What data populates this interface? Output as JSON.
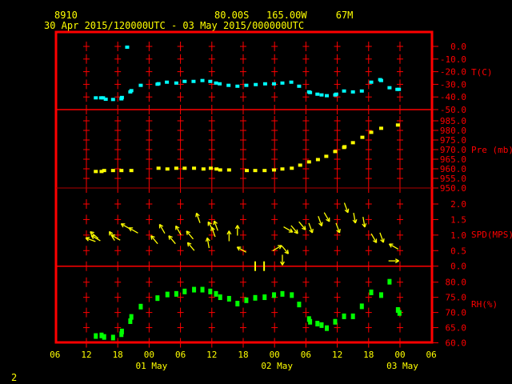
{
  "header": {
    "station": "8910",
    "location": "80.00S   165.00W     67M",
    "period": "30 Apr 2015/120000UTC - 03 May 2015/000000UTC"
  },
  "footer": {
    "page_number": "2"
  },
  "colors": {
    "frame": "#ff0000",
    "text": "#ffff00",
    "temperature": "#00ffff",
    "pressure": "#ffff00",
    "wind": "#ffff00",
    "rh": "#00ff00"
  },
  "chart_data": {
    "type": "scatter",
    "x_unit": "hours since 30 Apr 2015 12UTC",
    "xlim": [
      -6,
      66
    ],
    "x_ticks": [
      {
        "h": -6,
        "label": "06"
      },
      {
        "h": 0,
        "label": "12"
      },
      {
        "h": 6,
        "label": "18"
      },
      {
        "h": 12,
        "label": "00"
      },
      {
        "h": 18,
        "label": "06"
      },
      {
        "h": 24,
        "label": "12"
      },
      {
        "h": 30,
        "label": "18"
      },
      {
        "h": 36,
        "label": "00"
      },
      {
        "h": 42,
        "label": "06"
      },
      {
        "h": 48,
        "label": "12"
      },
      {
        "h": 54,
        "label": "18"
      },
      {
        "h": 60,
        "label": "00"
      },
      {
        "h": 66,
        "label": "06"
      }
    ],
    "date_labels": [
      {
        "h": 12,
        "label": "01 May"
      },
      {
        "h": 36,
        "label": "02 May"
      },
      {
        "h": 60,
        "label": "03 May"
      }
    ],
    "panels": [
      {
        "name": "temperature",
        "label": "T(C)",
        "ylim": [
          -50,
          0
        ],
        "ticks": [
          "0.0",
          "-10.0",
          "-20.0",
          "-30.0",
          "-40.0",
          "-50.0"
        ],
        "tick_values": [
          0,
          -10,
          -20,
          -30,
          -40,
          -50
        ],
        "points": [
          [
            1.8,
            -40.7
          ],
          [
            2.8,
            -40.7
          ],
          [
            3.2,
            -40.7
          ],
          [
            3.7,
            -41.8
          ],
          [
            5.1,
            -42
          ],
          [
            6.7,
            -41.5
          ],
          [
            6.8,
            -40.4
          ],
          [
            7.8,
            -0.6
          ],
          [
            8.4,
            -36
          ],
          [
            8.6,
            -35
          ],
          [
            10.4,
            -30.8
          ],
          [
            13.6,
            -29.9
          ],
          [
            13.8,
            -29.5
          ],
          [
            15.4,
            -28.3
          ],
          [
            17.2,
            -29
          ],
          [
            18.8,
            -27.7
          ],
          [
            20.5,
            -27.7
          ],
          [
            22.2,
            -27
          ],
          [
            23.7,
            -27.7
          ],
          [
            24.8,
            -29
          ],
          [
            25.5,
            -29.6
          ],
          [
            27.2,
            -30.8
          ],
          [
            28.9,
            -31.5
          ],
          [
            30.6,
            -30.8
          ],
          [
            32.4,
            -30.2
          ],
          [
            34.2,
            -29.6
          ],
          [
            35.9,
            -29.6
          ],
          [
            37.5,
            -29
          ],
          [
            39.2,
            -28.3
          ],
          [
            40.7,
            -31.5
          ],
          [
            42.6,
            -36
          ],
          [
            42.8,
            -36.5
          ],
          [
            44.2,
            -37.8
          ],
          [
            45,
            -38.4
          ],
          [
            46,
            -39
          ],
          [
            47.6,
            -38.4
          ],
          [
            47.8,
            -37.8
          ],
          [
            49.3,
            -35.3
          ],
          [
            51,
            -36
          ],
          [
            52.7,
            -35.3
          ],
          [
            54.5,
            -28.3
          ],
          [
            56.2,
            -26.3
          ],
          [
            56.4,
            -27
          ],
          [
            58,
            -32.7
          ],
          [
            59.5,
            -34
          ],
          [
            59.8,
            -34
          ]
        ]
      },
      {
        "name": "pressure",
        "label": "Pre (mb)",
        "ylim": [
          950,
          985
        ],
        "ticks": [
          "985.0",
          "980.0",
          "975.0",
          "970.0",
          "965.0",
          "960.0",
          "955.0",
          "950.0"
        ],
        "tick_values": [
          985,
          980,
          975,
          970,
          965,
          960,
          955,
          950
        ],
        "points": [
          [
            1.8,
            958.6
          ],
          [
            2.9,
            958.6
          ],
          [
            3.4,
            959.1
          ],
          [
            5.1,
            959.1
          ],
          [
            6.7,
            959.1
          ],
          [
            8.6,
            959.1
          ],
          [
            13.8,
            960.3
          ],
          [
            15.5,
            959.9
          ],
          [
            17.2,
            960.3
          ],
          [
            18.8,
            960.3
          ],
          [
            20.6,
            960.3
          ],
          [
            22.4,
            959.9
          ],
          [
            23.8,
            960.3
          ],
          [
            24.9,
            959.9
          ],
          [
            25.6,
            959.4
          ],
          [
            27.3,
            959.4
          ],
          [
            30.7,
            959.1
          ],
          [
            32.3,
            959.1
          ],
          [
            34.1,
            959.1
          ],
          [
            35.9,
            959.4
          ],
          [
            37.5,
            959.9
          ],
          [
            39.3,
            960.3
          ],
          [
            40.9,
            961.9
          ],
          [
            42.6,
            963.6
          ],
          [
            44.3,
            964.8
          ],
          [
            45.9,
            966.5
          ],
          [
            47.6,
            969
          ],
          [
            49.3,
            971.1
          ],
          [
            49.4,
            971.5
          ],
          [
            51,
            973.6
          ],
          [
            52.8,
            976.4
          ],
          [
            54.5,
            979
          ],
          [
            56.4,
            981.1
          ],
          [
            59.6,
            982.8
          ]
        ]
      },
      {
        "name": "wind_speed",
        "label": "SPD(MPS)",
        "ylim": [
          0,
          2
        ],
        "ticks": [
          "2.0",
          "1.5",
          "1.0",
          "0.5",
          "0.0"
        ],
        "tick_values": [
          2,
          1.5,
          1,
          0.5,
          0
        ],
        "points_note": "[hour, speed m/s, arrow direction degrees clockwise from up]",
        "points": [
          [
            0.8,
            0.85,
            290
          ],
          [
            1.8,
            0.9,
            300
          ],
          [
            1.5,
            1.0,
            310
          ],
          [
            4.9,
            0.97,
            330
          ],
          [
            5.6,
            0.92,
            300
          ],
          [
            7.5,
            1.28,
            300
          ],
          [
            9,
            1.15,
            300
          ],
          [
            13,
            0.85,
            320
          ],
          [
            14.5,
            1.2,
            330
          ],
          [
            16.4,
            0.85,
            320
          ],
          [
            17.6,
            1.15,
            330
          ],
          [
            19.8,
            1.0,
            320
          ],
          [
            20,
            0.63,
            320
          ],
          [
            21.4,
            1.55,
            340
          ],
          [
            23.3,
            0.75,
            350
          ],
          [
            23.8,
            1.28,
            330
          ],
          [
            24.8,
            1.3,
            340
          ],
          [
            24.3,
            1.1,
            340
          ],
          [
            27.3,
            0.97,
            0
          ],
          [
            28.9,
            1.15,
            0
          ],
          [
            29.7,
            0.53,
            300
          ],
          [
            32.3,
            0,
            0
          ],
          [
            34,
            0,
            0
          ],
          [
            36.5,
            0.58,
            60
          ],
          [
            38,
            0.53,
            140
          ],
          [
            37.5,
            0.2,
            180
          ],
          [
            38.6,
            1.18,
            120
          ],
          [
            39.8,
            1.18,
            140
          ],
          [
            41.3,
            1.3,
            140
          ],
          [
            42.9,
            1.23,
            160
          ],
          [
            44.7,
            1.45,
            160
          ],
          [
            46,
            1.58,
            150
          ],
          [
            48.1,
            1.23,
            160
          ],
          [
            49.7,
            1.88,
            160
          ],
          [
            51.3,
            1.55,
            170
          ],
          [
            53.1,
            1.42,
            170
          ],
          [
            55,
            0.9,
            150
          ],
          [
            56.5,
            0.92,
            160
          ],
          [
            58.8,
            0.63,
            300
          ],
          [
            58.8,
            0.17,
            90
          ]
        ]
      },
      {
        "name": "relative_humidity",
        "label": "RH(%)",
        "ylim": [
          60,
          80
        ],
        "ticks": [
          "80.0",
          "75.0",
          "70.0",
          "65.0",
          "60.0"
        ],
        "tick_values": [
          80,
          75,
          70,
          65,
          60
        ],
        "points": [
          [
            1.8,
            62.1
          ],
          [
            2.9,
            62.3
          ],
          [
            3.4,
            61.8
          ],
          [
            5.1,
            61.6
          ],
          [
            6.7,
            62.7
          ],
          [
            6.8,
            63.6
          ],
          [
            8.4,
            67
          ],
          [
            8.6,
            68.4
          ],
          [
            10.4,
            71.8
          ],
          [
            13.6,
            74.6
          ],
          [
            15.5,
            75.8
          ],
          [
            17.2,
            76
          ],
          [
            18.8,
            76.8
          ],
          [
            20.6,
            77.4
          ],
          [
            22.2,
            77.4
          ],
          [
            23.7,
            76.8
          ],
          [
            24.8,
            76
          ],
          [
            25.6,
            74.9
          ],
          [
            27.3,
            74.4
          ],
          [
            28.9,
            72.8
          ],
          [
            30.6,
            73.9
          ],
          [
            32.3,
            74.7
          ],
          [
            34.1,
            74.9
          ],
          [
            35.9,
            75.6
          ],
          [
            37.5,
            76
          ],
          [
            39.3,
            75.6
          ],
          [
            40.7,
            72.5
          ],
          [
            42.6,
            67.7
          ],
          [
            42.8,
            66.8
          ],
          [
            44.2,
            66.2
          ],
          [
            45,
            65.7
          ],
          [
            46,
            64.7
          ],
          [
            47.6,
            66.8
          ],
          [
            49.3,
            68.6
          ],
          [
            51,
            68.6
          ],
          [
            52.7,
            71.9
          ],
          [
            54.5,
            76.5
          ],
          [
            56.4,
            75.6
          ],
          [
            58,
            80
          ],
          [
            59.6,
            70.7
          ],
          [
            59.9,
            69.7
          ]
        ]
      }
    ]
  }
}
